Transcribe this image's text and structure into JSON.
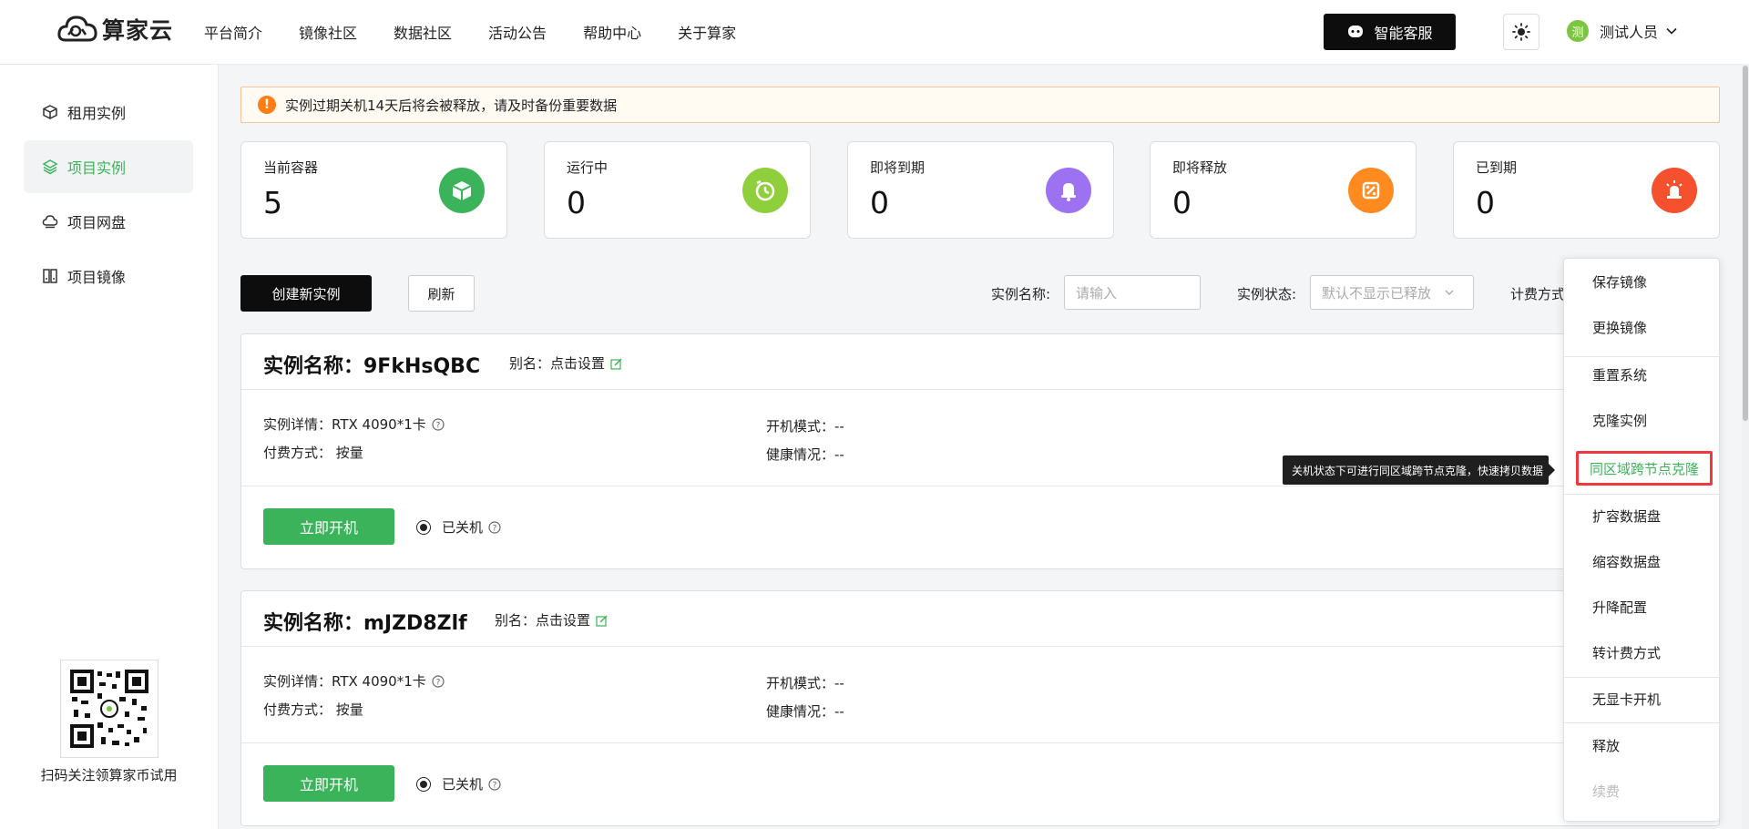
{
  "header": {
    "logo_text": "算家云",
    "nav": [
      "平台简介",
      "镜像社区",
      "数据社区",
      "活动公告",
      "帮助中心",
      "关于算家"
    ],
    "customer_service": "智能客服",
    "user_avatar": "测",
    "user_name": "测试人员"
  },
  "sidebar": {
    "items": [
      {
        "label": "租用实例",
        "icon": "cube-icon"
      },
      {
        "label": "项目实例",
        "icon": "layers-icon"
      },
      {
        "label": "项目网盘",
        "icon": "cloud-disk-icon"
      },
      {
        "label": "项目镜像",
        "icon": "image-stack-icon"
      }
    ],
    "active": "项目实例",
    "qr_caption": "扫码关注领算家币试用"
  },
  "notice": "实例过期关机14天后将会被释放，请及时备份重要数据",
  "stats": [
    {
      "label": "当前容器",
      "value": "5",
      "color": "#3bb35a",
      "icon": "container-icon"
    },
    {
      "label": "运行中",
      "value": "0",
      "color": "#8fcf3c",
      "icon": "running-icon"
    },
    {
      "label": "即将到期",
      "value": "0",
      "color": "#9c72f2",
      "icon": "bell-icon"
    },
    {
      "label": "即将释放",
      "value": "0",
      "color": "#ff8a1f",
      "icon": "release-icon"
    },
    {
      "label": "已到期",
      "value": "0",
      "color": "#f5512f",
      "icon": "alarm-icon"
    }
  ],
  "toolbar": {
    "create": "创建新实例",
    "refresh": "刷新",
    "name_label": "实例名称:",
    "name_placeholder": "请输入",
    "status_label": "实例状态:",
    "status_value": "默认不显示已释放",
    "billing_label": "计费方式"
  },
  "instances": [
    {
      "title": "实例名称：9FkHsQBC",
      "alias": "别名：点击设置",
      "detail": "实例详情：RTX 4090*1卡",
      "billing": "付费方式：  按量",
      "boot_mode": "开机模式：--",
      "health": "健康情况：--",
      "start_button": "立即开机",
      "status": "已关机"
    },
    {
      "title": "实例名称：mJZD8Zlf",
      "alias": "别名：点击设置",
      "detail": "实例详情：RTX 4090*1卡",
      "billing": "付费方式：  按量",
      "boot_mode": "开机模式：--",
      "health": "健康情况：--",
      "start_button": "立即开机",
      "status": "已关机"
    }
  ],
  "menu": {
    "items": [
      "保存镜像",
      "更换镜像",
      "重置系统",
      "克隆实例",
      "同区域跨节点克隆",
      "扩容数据盘",
      "缩容数据盘",
      "升降配置",
      "转计费方式",
      "无显卡开机",
      "释放",
      "续费"
    ],
    "highlighted": "同区域跨节点克隆",
    "disabled": "续费"
  },
  "tooltip": "关机状态下可进行同区域跨节点克隆，快速拷贝数据"
}
